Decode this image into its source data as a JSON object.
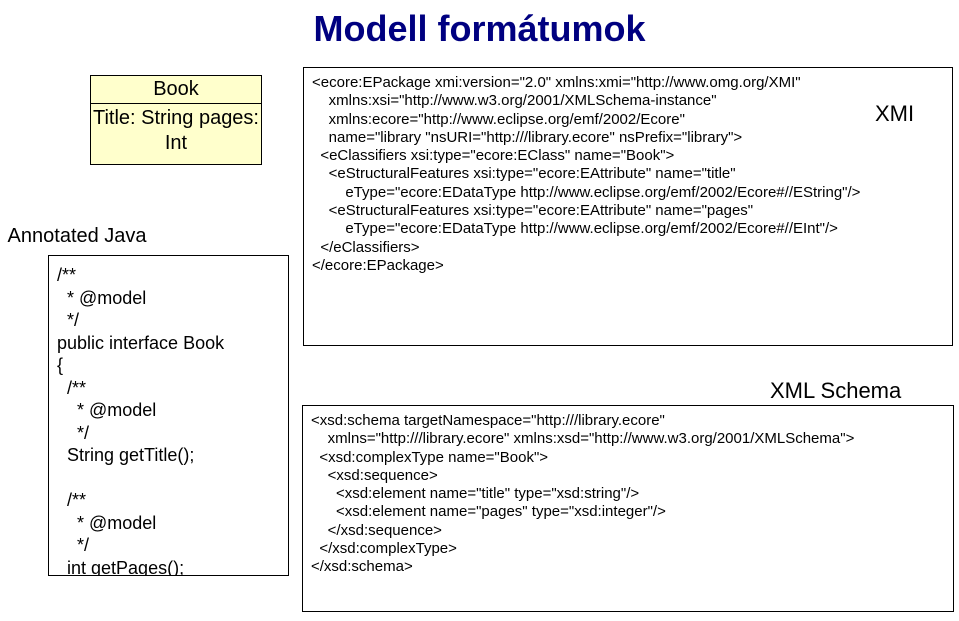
{
  "title": "Modell formátumok",
  "book": {
    "header": "Book",
    "body": "Title: String\npages: Int"
  },
  "annotated_label": " Annotated Java",
  "java_code": "/**\n  * @model\n  */\npublic interface Book\n{\n  /**\n    * @model\n    */\n  String getTitle();\n\n  /**\n    * @model\n    */\n  int getPages();\n}",
  "xmi_label": "XMI",
  "xmi_code": "<ecore:EPackage xmi:version=\"2.0\" xmlns:xmi=\"http://www.omg.org/XMI\"\n    xmlns:xsi=\"http://www.w3.org/2001/XMLSchema-instance\"\n    xmlns:ecore=\"http://www.eclipse.org/emf/2002/Ecore\"\n    name=\"library \"nsURI=\"http:///library.ecore\" nsPrefix=\"library\">\n  <eClassifiers xsi:type=\"ecore:EClass\" name=\"Book\">\n    <eStructuralFeatures xsi:type=\"ecore:EAttribute\" name=\"title\"\n        eType=\"ecore:EDataType http://www.eclipse.org/emf/2002/Ecore#//EString\"/>\n    <eStructuralFeatures xsi:type=\"ecore:EAttribute\" name=\"pages\"\n        eType=\"ecore:EDataType http://www.eclipse.org/emf/2002/Ecore#//EInt\"/>\n  </eClassifiers>\n</ecore:EPackage>",
  "xsd_label": "XML Schema",
  "xsd_code": "<xsd:schema targetNamespace=\"http:///library.ecore\"\n    xmlns=\"http:///library.ecore\" xmlns:xsd=\"http://www.w3.org/2001/XMLSchema\">\n  <xsd:complexType name=\"Book\">\n    <xsd:sequence>\n      <xsd:element name=\"title\" type=\"xsd:string\"/>\n      <xsd:element name=\"pages\" type=\"xsd:integer\"/>\n    </xsd:sequence>\n  </xsd:complexType>\n</xsd:schema>"
}
